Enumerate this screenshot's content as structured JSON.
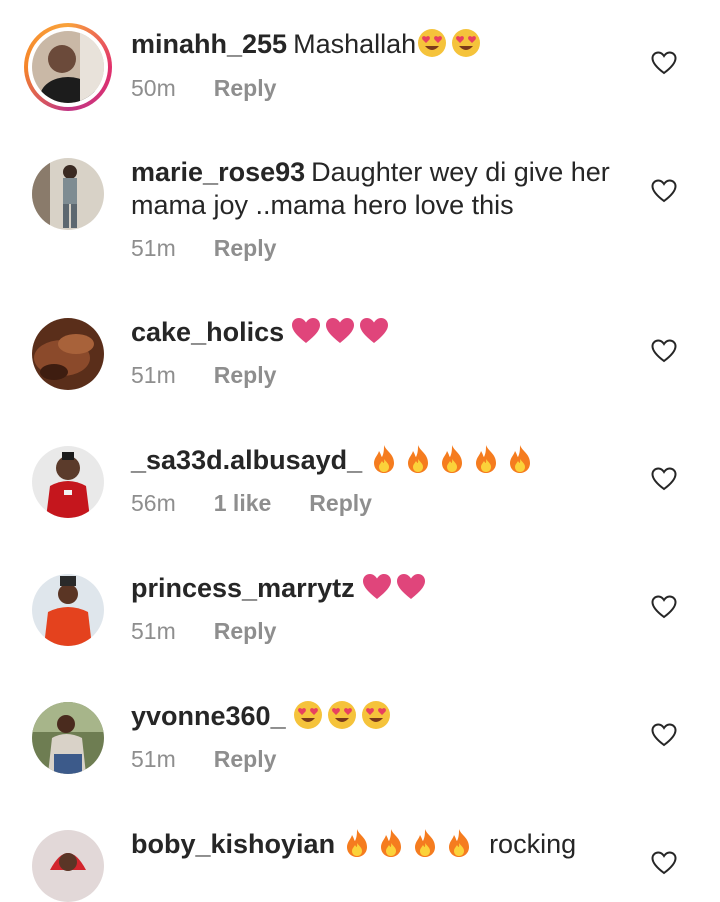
{
  "comments": [
    {
      "username": "minahh_255",
      "text": "Mashallah",
      "emojis": [
        "heart-eyes",
        "heart-eyes"
      ],
      "time": "50m",
      "likes": "",
      "reply": "Reply"
    },
    {
      "username": "marie_rose93",
      "text": "Daughter wey di give her mama joy ..mama hero love this",
      "emojis": [],
      "time": "51m",
      "likes": "",
      "reply": "Reply"
    },
    {
      "username": "cake_holics",
      "text": "",
      "emojis": [
        "pink-heart",
        "pink-heart",
        "pink-heart"
      ],
      "time": "51m",
      "likes": "",
      "reply": "Reply"
    },
    {
      "username": "_sa33d.albusayd_",
      "text": "",
      "emojis": [
        "fire",
        "fire",
        "fire",
        "fire",
        "fire"
      ],
      "time": "56m",
      "likes": "1 like",
      "reply": "Reply"
    },
    {
      "username": "princess_marrytz",
      "text": "",
      "emojis": [
        "pink-heart",
        "pink-heart"
      ],
      "time": "51m",
      "likes": "",
      "reply": "Reply"
    },
    {
      "username": "yvonne360_",
      "text": "",
      "emojis": [
        "heart-eyes",
        "heart-eyes",
        "heart-eyes"
      ],
      "time": "51m",
      "likes": "",
      "reply": "Reply"
    },
    {
      "username": "boby_kishoyian",
      "text": "rocking",
      "emojis": [
        "fire",
        "fire",
        "fire",
        "fire"
      ],
      "time": "",
      "likes": "",
      "reply": ""
    }
  ],
  "colors": {
    "text": "#262626",
    "meta": "#8e8e8e",
    "pink": "#e0457b",
    "fire": "#f57c1f",
    "emoji_face": "#f5c33b"
  }
}
